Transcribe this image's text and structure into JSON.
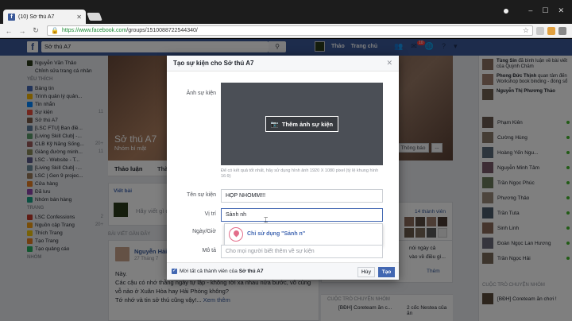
{
  "browser": {
    "tab_title": "(10) Sở thú A7",
    "url_domain": "https://www.facebook.com",
    "url_path": "/groups/1510088722544340/"
  },
  "fb": {
    "search_value": "Sở thú A7",
    "nav_user": "Thảo",
    "nav_home": "Trang chủ",
    "notif_count": "10"
  },
  "left": {
    "items": [
      {
        "label": "Nguyễn Văn Thảo",
        "count": ""
      },
      {
        "label": "Chỉnh sửa trang cá nhân",
        "count": ""
      }
    ],
    "fav_head": "YÊU THÍCH",
    "fav": [
      {
        "label": "Bảng tin",
        "count": ""
      },
      {
        "label": "Trình quản lý quản...",
        "count": ""
      },
      {
        "label": "Tin nhắn",
        "count": ""
      },
      {
        "label": "Sự kiện",
        "count": "11"
      },
      {
        "label": "Sở thú A7",
        "count": ""
      },
      {
        "label": "[LSC FTU] Ban điề...",
        "count": ""
      },
      {
        "label": "[Living Skill Club] -...",
        "count": ""
      },
      {
        "label": "CLB Kỹ Năng Sống...",
        "count": "20+"
      },
      {
        "label": "Giảng đường minh...",
        "count": "11"
      },
      {
        "label": "LSC - Website - T...",
        "count": ""
      },
      {
        "label": "[Living Skill Club] -...",
        "count": ""
      },
      {
        "label": "LSC | Gen 9 projec...",
        "count": ""
      },
      {
        "label": "Cửa hàng",
        "count": ""
      },
      {
        "label": "Đã lưu",
        "count": ""
      },
      {
        "label": "Nhóm bán hàng",
        "count": ""
      }
    ],
    "page_head": "TRANG",
    "pages": [
      {
        "label": "LSC Confessions",
        "count": "2"
      },
      {
        "label": "Nguồn cập Trang",
        "count": "20+"
      },
      {
        "label": "Thích Trang",
        "count": ""
      },
      {
        "label": "Tạo Trang",
        "count": ""
      },
      {
        "label": "Tạo quảng cáo",
        "count": ""
      }
    ],
    "group_head": "NHÓM"
  },
  "group": {
    "name": "Sở thú A7",
    "privacy": "Nhóm bí mật",
    "tab_discussion": "Thảo luận",
    "tab_2": "Thà",
    "composer_tab": "Viết bài",
    "composer_placeholder": "Hãy viết gì đ",
    "recent_head": "BÀI VIẾT GẦN ĐÂY",
    "notify_btn": "Thông báo",
    "more_btn": "..."
  },
  "post": {
    "author": "Nguyễn Hải",
    "time": "27 Tháng 7",
    "line1": "Này.",
    "line2": "Các cậu có nhớ thằng ngày tự lập - không rời xa nhau nửa bước, vỗ cùng",
    "line3": "vỗ nảo ở Xuân Hòa hay Hải Phòng không?",
    "line4": "Tớ nhớ và tin sở thú cũng vậy!...",
    "more": "Xem thêm"
  },
  "center_right": {
    "members": "14 thành viên",
    "l1": "nói ngày cả",
    "l2": "vào về điều gì...",
    "l3": "Thêm"
  },
  "chats": {
    "head": "CUỘC TRÒ CHUYỆN NHÓM",
    "c1": "[BĐH] Coreteam ăn c...",
    "c2": "2 cốc Nestea của ăn"
  },
  "right": {
    "ticker": [
      {
        "name": "Tùng Sin",
        "text": "đã bình luận về bài viết của Quỳnh Châm"
      },
      {
        "name": "Phong Đức Thịnh",
        "text": "quan tâm đến Workshop book binding - đóng sổ"
      },
      {
        "name": "Nguyễn Thị Phương Thảo",
        "text": ""
      }
    ],
    "friends": [
      "Phạm Kiên",
      "Cường Hùng",
      "Hoàng Yến Ngu...",
      "Nguyễn Minh Tâm",
      "Trần Ngọc Phúc",
      "Phương Thảo",
      "Trần Tuta",
      "Sinh Linh",
      "Đoàn Ngọc Lan Hương",
      "Trần Ngọc Hải"
    ],
    "chat_head": "CUỘC TRÒ CHUYỆN NHÓM",
    "chat1": "[BĐH] Coreteam ăn chơi !"
  },
  "modal": {
    "title": "Tạo sự kiện cho Sở thú A7",
    "photo_label": "Ảnh sự kiện",
    "add_photo": "Thêm ảnh sự kiện",
    "photo_hint": "Để có kết quả tốt nhất, hãy sử dụng hình ảnh 1920 X 1080 pixel (tỷ lệ khung hình 16:9)",
    "name_label": "Tên sự kiện",
    "name_value": "HỌP NHOMM!!!",
    "location_label": "Vị trí",
    "location_value": "Sảnh nh",
    "date_label": "Ngày/Giờ",
    "desc_label": "Mô tả",
    "desc_placeholder": "Cho mọi người biết thêm về sự kiện",
    "suggestion": "Chỉ sử dụng \"Sảnh n\"",
    "invite_text_pre": "Mời tất cả thành viên của ",
    "invite_group": "Sở thú A7",
    "cancel": "Hủy",
    "create": "Tạo"
  }
}
